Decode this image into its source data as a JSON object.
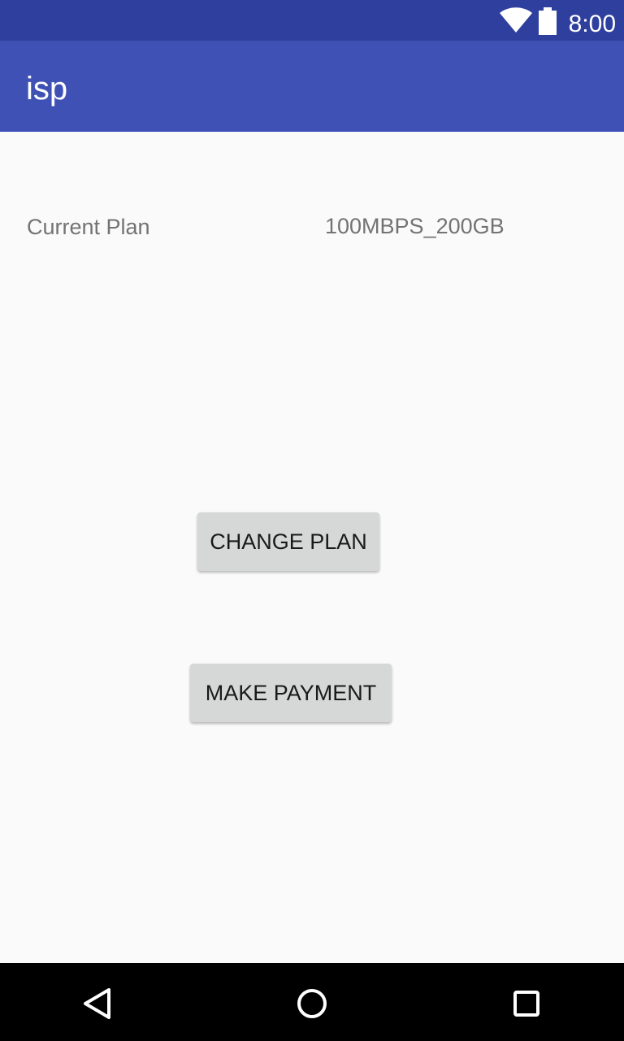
{
  "status_bar": {
    "time": "8:00",
    "icons": [
      "wifi-icon",
      "battery-icon"
    ]
  },
  "app_bar": {
    "title": "isp"
  },
  "plan": {
    "label": "Current Plan",
    "value": "100MBPS_200GB"
  },
  "actions": {
    "change_plan_label": "CHANGE PLAN",
    "make_payment_label": "MAKE PAYMENT"
  },
  "nav_bar": {
    "icons": [
      "back-icon",
      "home-icon",
      "recent-apps-icon"
    ]
  },
  "colors": {
    "status_bar": "#2f3f9e",
    "app_bar": "#3f51b5",
    "background": "#fafafa",
    "button": "#d6d7d7",
    "secondary_text": "#737373",
    "nav_bar": "#000000"
  }
}
